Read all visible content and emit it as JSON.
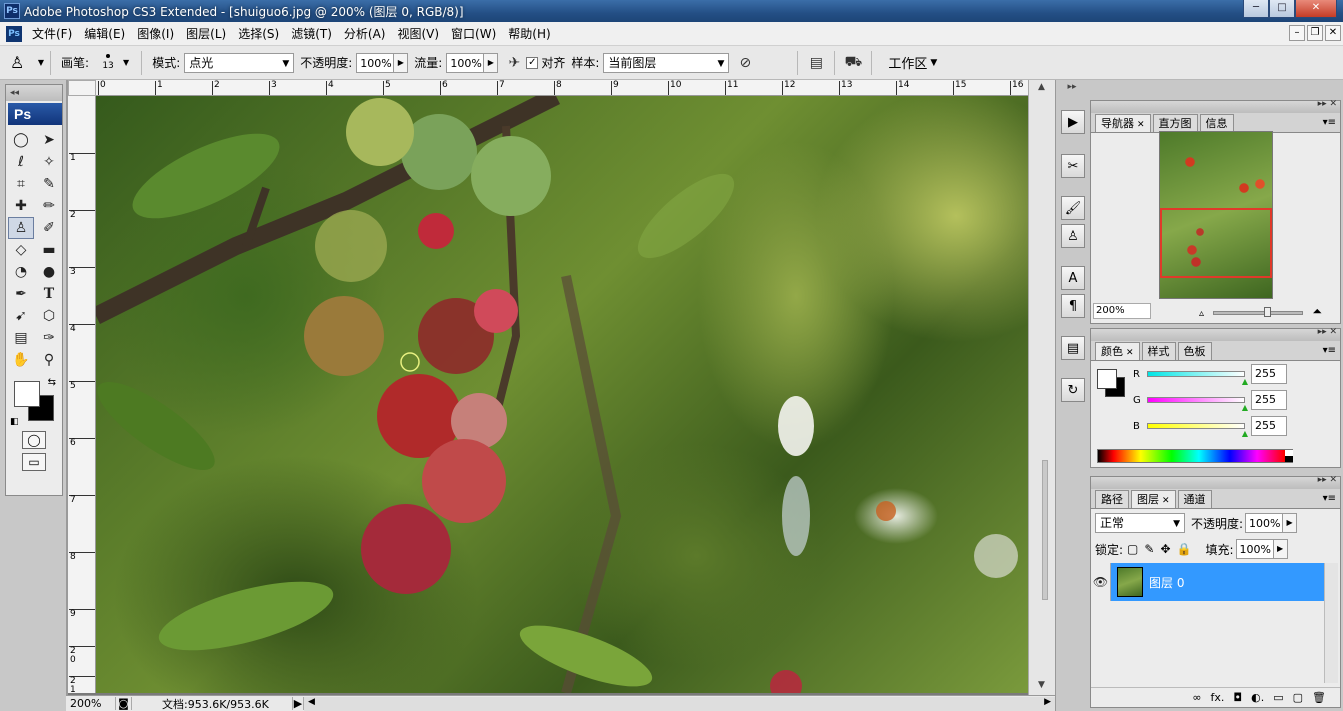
{
  "window": {
    "title": "Adobe Photoshop CS3 Extended - [shuiguo6.jpg @ 200% (图层 0, RGB/8)]",
    "app_icon": "Ps",
    "controls": {
      "minimize": "─",
      "maximize": "□",
      "close": "✕"
    }
  },
  "menubar": {
    "badge": "Ps",
    "items": [
      "文件(F)",
      "编辑(E)",
      "图像(I)",
      "图层(L)",
      "选择(S)",
      "滤镜(T)",
      "分析(A)",
      "视图(V)",
      "窗口(W)",
      "帮助(H)"
    ],
    "doc_controls": {
      "minimize": "–",
      "restore": "❐",
      "close": "✕"
    }
  },
  "options": {
    "brush_label": "画笔:",
    "brush_size": "13",
    "mode_label": "模式:",
    "mode_value": "点光",
    "opacity_label": "不透明度:",
    "opacity_value": "100%",
    "flow_label": "流量:",
    "flow_value": "100%",
    "aligned_label": "对齐",
    "aligned_checked": "✓",
    "sample_label": "样本:",
    "sample_value": "当前图层",
    "workspace_label": "工作区"
  },
  "toolbox": {
    "logo": "Ps",
    "tools": [
      {
        "name": "marquee-tool-icon",
        "glyph": "◯"
      },
      {
        "name": "move-tool-icon",
        "glyph": "➤"
      },
      {
        "name": "lasso-tool-icon",
        "glyph": "ℓ"
      },
      {
        "name": "magic-wand-tool-icon",
        "glyph": "✧"
      },
      {
        "name": "crop-tool-icon",
        "glyph": "⌗"
      },
      {
        "name": "slice-tool-icon",
        "glyph": "✎"
      },
      {
        "name": "healing-brush-tool-icon",
        "glyph": "✚"
      },
      {
        "name": "brush-tool-icon",
        "glyph": "✏"
      },
      {
        "name": "clone-stamp-tool-icon",
        "glyph": "♙"
      },
      {
        "name": "history-brush-tool-icon",
        "glyph": "✐"
      },
      {
        "name": "eraser-tool-icon",
        "glyph": "◇"
      },
      {
        "name": "gradient-tool-icon",
        "glyph": "▬"
      },
      {
        "name": "blur-tool-icon",
        "glyph": "💧"
      },
      {
        "name": "dodge-tool-icon",
        "glyph": "●"
      },
      {
        "name": "pen-tool-icon",
        "glyph": "✒"
      },
      {
        "name": "type-tool-icon",
        "glyph": "T"
      },
      {
        "name": "path-selection-tool-icon",
        "glyph": "➹"
      },
      {
        "name": "shape-tool-icon",
        "glyph": "⬡"
      },
      {
        "name": "notes-tool-icon",
        "glyph": "▤"
      },
      {
        "name": "eyedropper-tool-icon",
        "glyph": "✑"
      },
      {
        "name": "hand-tool-icon",
        "glyph": "✋"
      },
      {
        "name": "zoom-tool-icon",
        "glyph": "🔍"
      }
    ],
    "active_tool": "clone-stamp-tool-icon"
  },
  "ruler": {
    "h_labels": [
      "0",
      "1",
      "2",
      "3",
      "4",
      "5",
      "6",
      "7",
      "8",
      "9",
      "10",
      "11",
      "12",
      "13",
      "14",
      "15",
      "16"
    ],
    "v_labels": [
      "1",
      "2",
      "3",
      "4",
      "5",
      "6",
      "7",
      "8",
      "9",
      "2 0",
      "2 1"
    ]
  },
  "status": {
    "zoom": "200%",
    "doc_info": "文档:953.6K/953.6K"
  },
  "panels": {
    "navigator": {
      "tabs": [
        "导航器",
        "直方图",
        "信息"
      ],
      "zoom": "200%"
    },
    "color": {
      "tabs": [
        "颜色",
        "样式",
        "色板"
      ],
      "channels": [
        {
          "label": "R",
          "value": "255",
          "color": "#00e5e5"
        },
        {
          "label": "G",
          "value": "255",
          "color": "#ff00ff"
        },
        {
          "label": "B",
          "value": "255",
          "color": "#ffff00"
        }
      ]
    },
    "layers": {
      "tabs": [
        "路径",
        "图层",
        "通道"
      ],
      "blend_mode": "正常",
      "opacity_label": "不透明度:",
      "opacity_value": "100%",
      "lock_label": "锁定:",
      "fill_label": "填充:",
      "fill_value": "100%",
      "items": [
        {
          "name": "图层 0",
          "selected": true
        }
      ],
      "footer_icons": [
        "∞",
        "fx.",
        "◘",
        "◐.",
        "▭",
        "▢",
        "🗑"
      ]
    }
  },
  "colors": {
    "selection": "#3399ff",
    "navigator_view": "#e0392a"
  }
}
